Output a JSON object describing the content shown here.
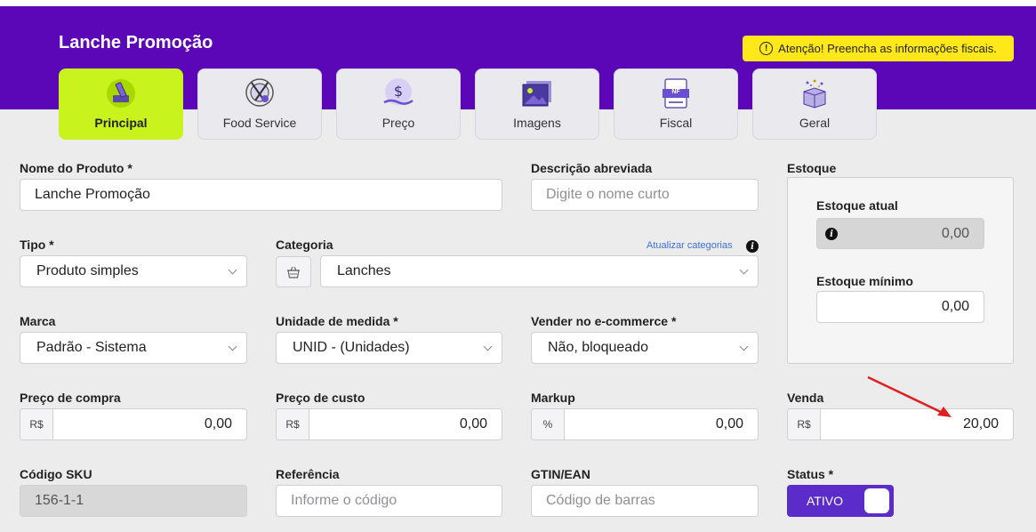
{
  "header": {
    "title": "Lanche Promoção",
    "alert_icon": "!",
    "alert_text": "Atenção! Preencha as informações fiscais."
  },
  "tabs": [
    {
      "label": "Principal",
      "icon": "pencil-icon",
      "active": true
    },
    {
      "label": "Food Service",
      "icon": "food-service-icon",
      "active": false
    },
    {
      "label": "Preço",
      "icon": "price-icon",
      "active": false
    },
    {
      "label": "Imagens",
      "icon": "images-icon",
      "active": false
    },
    {
      "label": "Fiscal",
      "icon": "fiscal-icon",
      "badge": "NF",
      "active": false
    },
    {
      "label": "Geral",
      "icon": "box-icon",
      "active": false
    }
  ],
  "form": {
    "nome": {
      "label": "Nome do Produto *",
      "value": "Lanche Promoção"
    },
    "descricao": {
      "label": "Descrição abreviada",
      "placeholder": "Digite o nome curto"
    },
    "tipo": {
      "label": "Tipo *",
      "value": "Produto simples"
    },
    "categoria": {
      "label": "Categoria",
      "value": "Lanches",
      "link": "Atualizar categorias"
    },
    "marca": {
      "label": "Marca",
      "value": "Padrão - Sistema"
    },
    "unidade": {
      "label": "Unidade de medida *",
      "value": "UNID - (Unidades)"
    },
    "ecommerce": {
      "label": "Vender no e-commerce *",
      "value": "Não, bloqueado"
    },
    "preco_compra": {
      "label": "Preço de compra",
      "prefix": "R$",
      "value": "0,00"
    },
    "preco_custo": {
      "label": "Preço de custo",
      "prefix": "R$",
      "value": "0,00"
    },
    "markup": {
      "label": "Markup",
      "prefix": "%",
      "value": "0,00"
    },
    "venda": {
      "label": "Venda",
      "prefix": "R$",
      "value": "20,00"
    },
    "sku": {
      "label": "Código SKU",
      "value": "156-1-1"
    },
    "referencia": {
      "label": "Referência",
      "placeholder": "Informe o código"
    },
    "gtin": {
      "label": "GTIN/EAN",
      "placeholder": "Código de barras"
    },
    "status": {
      "label": "Status *",
      "value": "ATIVO"
    }
  },
  "estoque": {
    "label": "Estoque",
    "atual_label": "Estoque atual",
    "atual_value": "0,00",
    "atual_info": "i",
    "minimo_label": "Estoque mínimo",
    "minimo_value": "0,00"
  },
  "colors": {
    "header": "#5b07b8",
    "active_tab": "#c8f31d",
    "alert": "#ffe81a",
    "toggle": "#5b2cc9",
    "arrow": "#e02020"
  }
}
